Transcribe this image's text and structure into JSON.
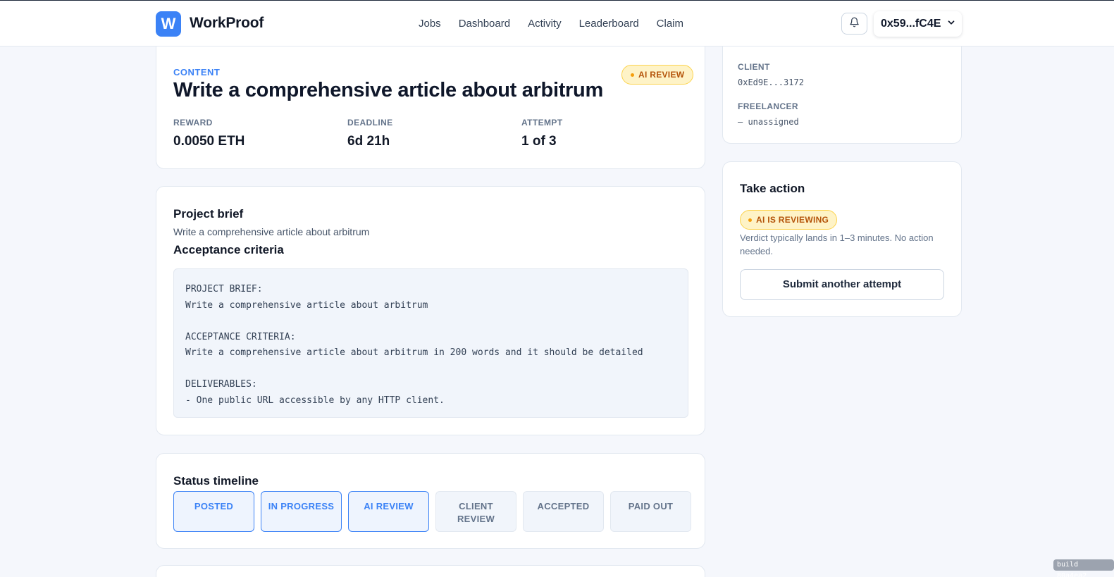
{
  "brand": {
    "mark": "W",
    "name": "WorkProof",
    "accent": "#3b82f6"
  },
  "nav": [
    {
      "label": "Jobs"
    },
    {
      "label": "Dashboard"
    },
    {
      "label": "Activity"
    },
    {
      "label": "Leaderboard"
    },
    {
      "label": "Claim"
    }
  ],
  "header": {
    "bell_icon": "bell-icon",
    "wallet": "0x59...fC4E"
  },
  "job": {
    "category": "CONTENT",
    "title": "Write a comprehensive article about arbitrum",
    "status": "AI REVIEW",
    "stats": [
      {
        "label": "REWARD",
        "value": "0.0050 ETH"
      },
      {
        "label": "DEADLINE",
        "value": "6d 21h"
      },
      {
        "label": "ATTEMPT",
        "value": "1 of 3"
      }
    ]
  },
  "brief": {
    "heading": "Project brief",
    "text": "Write a comprehensive article about arbitrum",
    "criteria_heading": "Acceptance criteria",
    "criteria_body": "PROJECT BRIEF:\nWrite a comprehensive article about arbitrum\n\nACCEPTANCE CRITERIA:\nWrite a comprehensive article about arbitrum in 200 words and it should be detailed\n\nDELIVERABLES:\n- One public URL accessible by any HTTP client."
  },
  "timeline": {
    "heading": "Status timeline",
    "steps": [
      {
        "label": "POSTED",
        "done": true
      },
      {
        "label": "IN PROGRESS",
        "done": true
      },
      {
        "label": "AI REVIEW",
        "done": true
      },
      {
        "label": "CLIENT REVIEW",
        "done": false
      },
      {
        "label": "ACCEPTED",
        "done": false
      },
      {
        "label": "PAID OUT",
        "done": false
      }
    ]
  },
  "parties": {
    "client_label": "CLIENT",
    "client_value": "0xEd9E...3172",
    "freelancer_label": "FREELANCER",
    "freelancer_value": "— unassigned"
  },
  "action": {
    "heading": "Take action",
    "pill": "AI IS REVIEWING",
    "note": "Verdict typically lands in 1–3 minutes. No action needed.",
    "button": "Submit another attempt"
  },
  "build": "build 80a4ea2"
}
